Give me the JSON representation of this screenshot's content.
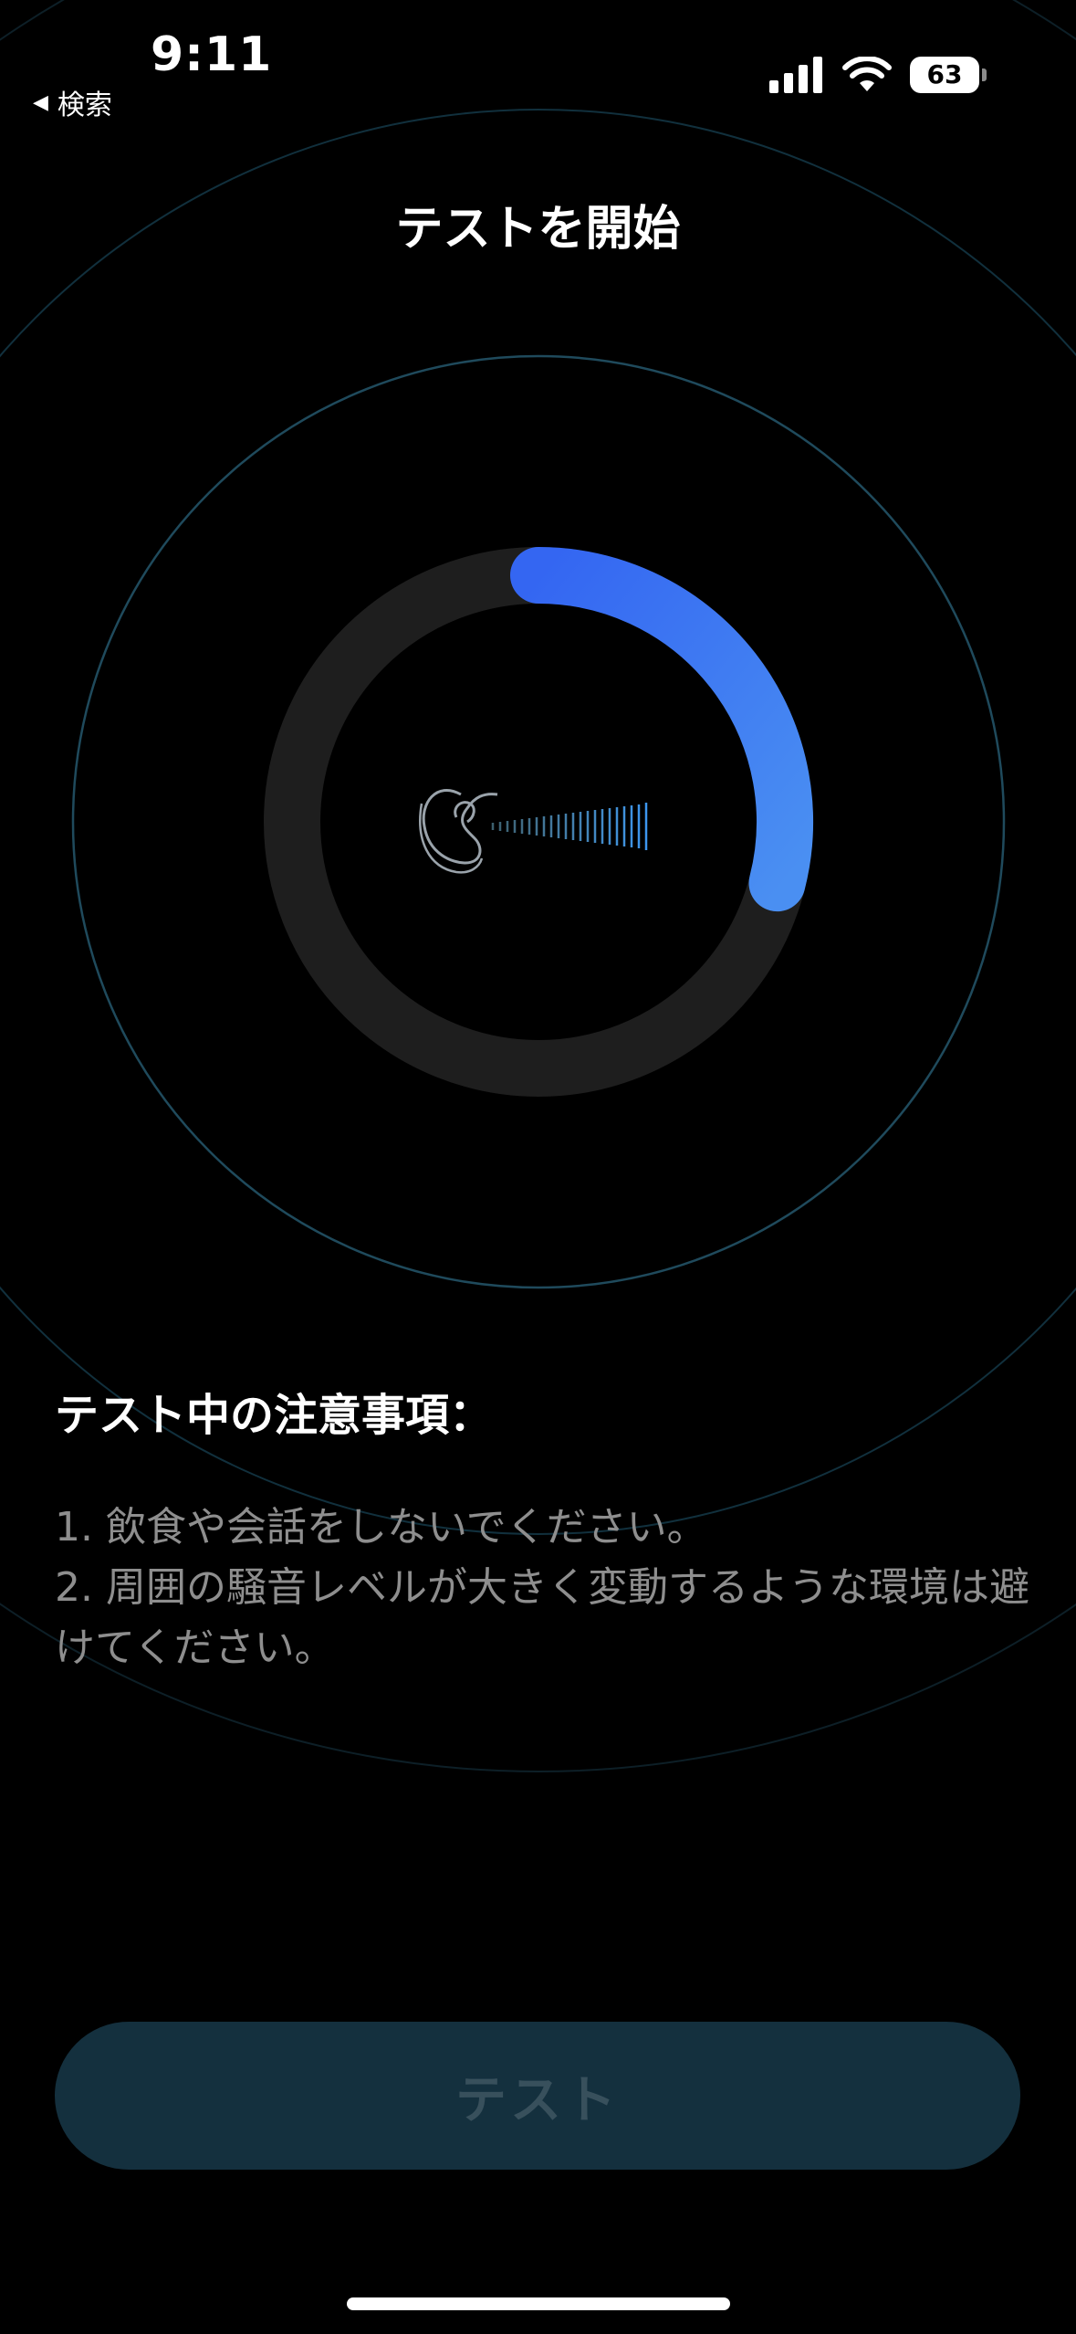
{
  "status_bar": {
    "time": "9:11",
    "back_label": "検索",
    "back_arrow": "◀",
    "battery_level": "63",
    "icons": [
      "cellular-signal-icon",
      "wifi-icon",
      "battery-icon"
    ]
  },
  "header": {
    "title": "テストを開始"
  },
  "progress": {
    "fraction": 0.29,
    "colors": {
      "track": "#1e1e1e",
      "arc_start": "#3466f2",
      "arc_end": "#4a8ff2",
      "ring": "#1f4a5c"
    }
  },
  "graphic": {
    "icon": "ear-sound-wave-icon"
  },
  "notes": {
    "heading": "テスト中の注意事項：",
    "items": [
      "1. 飲食や会話をしないでください。",
      "2. 周囲の騒音レベルが大きく変動するような環境は避けてください。"
    ]
  },
  "actions": {
    "test_label": "テスト"
  },
  "colors": {
    "background": "#000000",
    "button_bg": "#14303e",
    "button_text": "#38505c",
    "notes_text": "#8e8e8e"
  }
}
